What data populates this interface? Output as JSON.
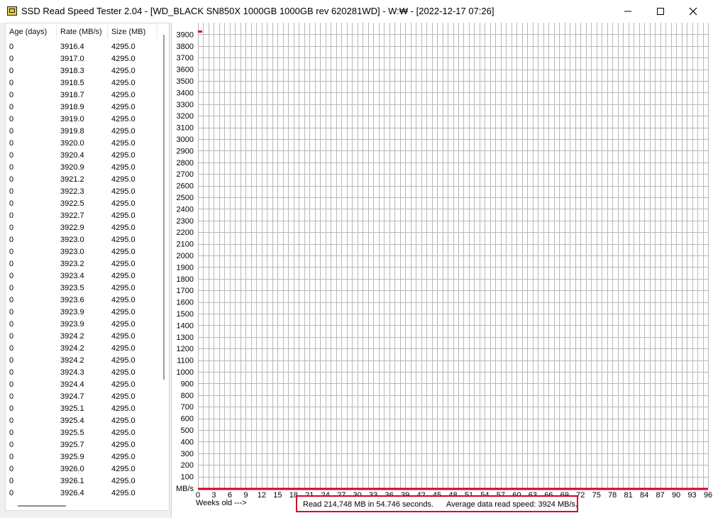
{
  "window": {
    "title": "SSD Read Speed Tester 2.04 - [WD_BLACK SN850X 1000GB 1000GB rev 620281WD] - W:₩ - [2022-12-17 07:26]",
    "icon": "disk-drive-icon"
  },
  "list": {
    "columns": [
      "Age (days)",
      "Rate (MB/s)",
      "Size (MB)"
    ],
    "rows": [
      [
        "0",
        "3916.4",
        "4295.0"
      ],
      [
        "0",
        "3917.0",
        "4295.0"
      ],
      [
        "0",
        "3918.3",
        "4295.0"
      ],
      [
        "0",
        "3918.5",
        "4295.0"
      ],
      [
        "0",
        "3918.7",
        "4295.0"
      ],
      [
        "0",
        "3918.9",
        "4295.0"
      ],
      [
        "0",
        "3919.0",
        "4295.0"
      ],
      [
        "0",
        "3919.8",
        "4295.0"
      ],
      [
        "0",
        "3920.0",
        "4295.0"
      ],
      [
        "0",
        "3920.4",
        "4295.0"
      ],
      [
        "0",
        "3920.9",
        "4295.0"
      ],
      [
        "0",
        "3921.2",
        "4295.0"
      ],
      [
        "0",
        "3922.3",
        "4295.0"
      ],
      [
        "0",
        "3922.5",
        "4295.0"
      ],
      [
        "0",
        "3922.7",
        "4295.0"
      ],
      [
        "0",
        "3922.9",
        "4295.0"
      ],
      [
        "0",
        "3923.0",
        "4295.0"
      ],
      [
        "0",
        "3923.0",
        "4295.0"
      ],
      [
        "0",
        "3923.2",
        "4295.0"
      ],
      [
        "0",
        "3923.4",
        "4295.0"
      ],
      [
        "0",
        "3923.5",
        "4295.0"
      ],
      [
        "0",
        "3923.6",
        "4295.0"
      ],
      [
        "0",
        "3923.9",
        "4295.0"
      ],
      [
        "0",
        "3923.9",
        "4295.0"
      ],
      [
        "0",
        "3924.2",
        "4295.0"
      ],
      [
        "0",
        "3924.2",
        "4295.0"
      ],
      [
        "0",
        "3924.2",
        "4295.0"
      ],
      [
        "0",
        "3924.3",
        "4295.0"
      ],
      [
        "0",
        "3924.4",
        "4295.0"
      ],
      [
        "0",
        "3924.7",
        "4295.0"
      ],
      [
        "0",
        "3925.1",
        "4295.0"
      ],
      [
        "0",
        "3925.4",
        "4295.0"
      ],
      [
        "0",
        "3925.5",
        "4295.0"
      ],
      [
        "0",
        "3925.7",
        "4295.0"
      ],
      [
        "0",
        "3925.9",
        "4295.0"
      ],
      [
        "0",
        "3926.0",
        "4295.0"
      ],
      [
        "0",
        "3926.1",
        "4295.0"
      ],
      [
        "0",
        "3926.4",
        "4295.0"
      ]
    ]
  },
  "chart_data": {
    "type": "line",
    "y_ticks": [
      "3900",
      "3800",
      "3700",
      "3600",
      "3500",
      "3400",
      "3300",
      "3200",
      "3100",
      "3000",
      "2900",
      "2800",
      "2700",
      "2600",
      "2500",
      "2400",
      "2300",
      "2200",
      "2100",
      "2000",
      "1900",
      "1800",
      "1700",
      "1600",
      "1500",
      "1400",
      "1300",
      "1200",
      "1100",
      "1000",
      "900",
      "800",
      "700",
      "600",
      "500",
      "400",
      "300",
      "200",
      "100"
    ],
    "y_unit_label": "MB/s",
    "x_ticks": [
      "0",
      "3",
      "6",
      "9",
      "12",
      "15",
      "18",
      "21",
      "24",
      "27",
      "30",
      "33",
      "36",
      "39",
      "42",
      "45",
      "48",
      "51",
      "54",
      "57",
      "60",
      "63",
      "66",
      "69",
      "72",
      "75",
      "78",
      "81",
      "84",
      "87",
      "90",
      "93",
      "96"
    ],
    "xlabel": "Weeks old --->",
    "ylim": [
      0,
      3950
    ],
    "xlim": [
      0,
      96
    ],
    "grid": true,
    "series": [
      {
        "color": "#d4002a",
        "points": [
          [
            0,
            3924
          ]
        ]
      },
      {
        "color": "#d4002a",
        "points": [
          [
            0,
            0
          ],
          [
            96,
            0
          ]
        ]
      }
    ]
  },
  "status": {
    "read_text": "Read 214,748 MB in 54.746 seconds.",
    "avg_text": "Average data read speed: 3924 MB/s."
  },
  "colors": {
    "accent": "#d4002a",
    "grid": "#b8b8b8"
  }
}
